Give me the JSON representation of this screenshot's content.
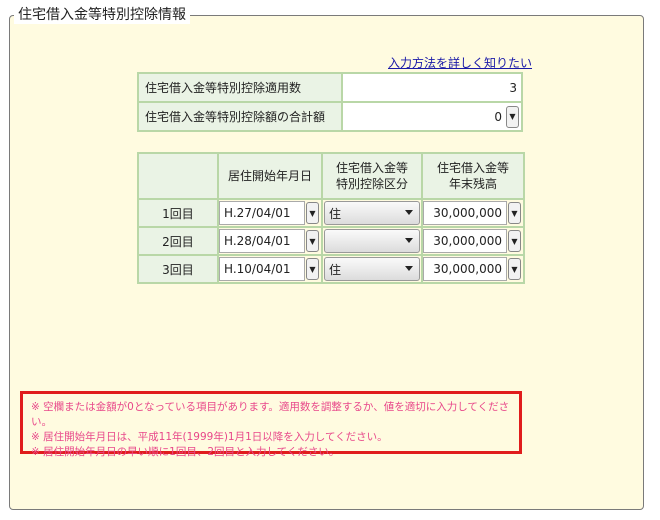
{
  "section": {
    "title": "住宅借入金等特別控除情報"
  },
  "help_link": "入力方法を詳しく知りたい",
  "summary": {
    "count_label": "住宅借入金等特別控除適用数",
    "count_value": "3",
    "total_label": "住宅借入金等特別控除額の合計額",
    "total_value": "0"
  },
  "grid": {
    "headers": [
      "",
      "居住開始年月日",
      "住宅借入金等\n特別控除区分",
      "住宅借入金等\n年末残高"
    ],
    "rows": [
      {
        "label": "1回目",
        "date": "H.27/04/01",
        "category": "住",
        "balance": "30,000,000"
      },
      {
        "label": "2回目",
        "date": "H.28/04/01",
        "category": "",
        "balance": "30,000,000"
      },
      {
        "label": "3回目",
        "date": "H.10/04/01",
        "category": "住",
        "balance": "30,000,000"
      }
    ]
  },
  "errors": [
    "※ 空欄または金額が0となっている項目があります。適用数を調整するか、値を適切に入力してください。",
    "※ 居住開始年月日は、平成11年(1999年)1月1日以降を入力してください。",
    "※ 居住開始年月日の早い順に1回目、2回目と入力してください。"
  ],
  "colors": {
    "error_border": "#e01c1c",
    "error_text": "#e8488a",
    "panel_bg": "#fffbe0",
    "cell_label_bg": "#eaf3e5"
  },
  "icons": {
    "spin": "chevron-down-icon",
    "select_arrow": "caret-down-icon"
  }
}
